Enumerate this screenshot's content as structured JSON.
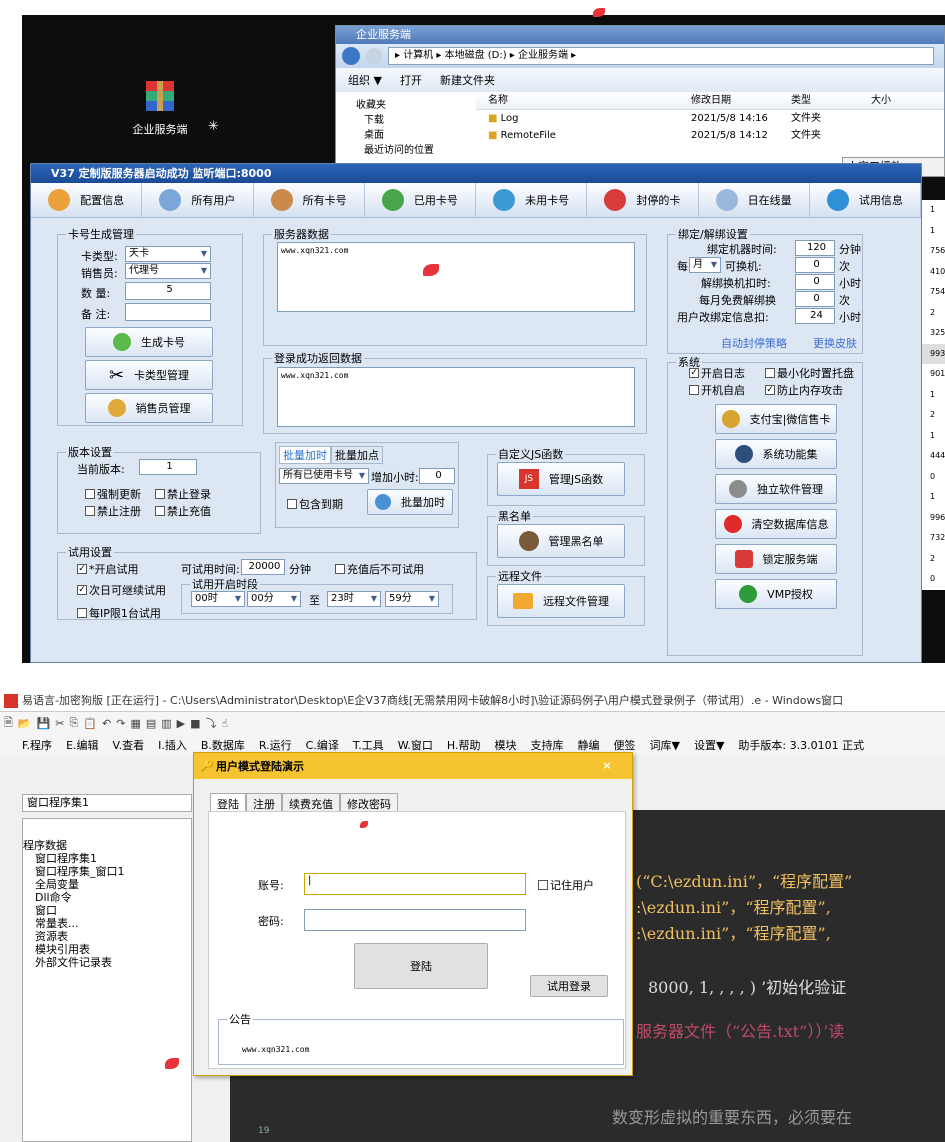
{
  "desktop": {
    "icon_label": "企业服务端"
  },
  "explorer": {
    "title": "企业服务端",
    "address": "▸ 计算机 ▸ 本地磁盘 (D:) ▸ 企业服务端 ▸",
    "toolbar": {
      "organize": "组织 ▼",
      "open": "打开",
      "new_folder": "新建文件夹"
    },
    "nav": [
      "收藏夹",
      "下载",
      "桌面",
      "最近访问的位置"
    ],
    "headers": {
      "name": "名称",
      "date": "修改日期",
      "type": "类型",
      "size": "大小"
    },
    "rows": [
      {
        "name": "Log",
        "date": "2021/5/8 14:16",
        "type": "文件夹"
      },
      {
        "name": "RemoteFile",
        "date": "2021/5/8 14:12",
        "type": "文件夹"
      }
    ]
  },
  "mini_player": "小窗口播放",
  "right_numbers": [
    "1",
    "1",
    "756",
    "410",
    "754",
    "2",
    "325",
    "993",
    "901",
    "1",
    "2",
    "1",
    "444",
    "0",
    "1",
    "996",
    "732",
    "2",
    "0"
  ],
  "server": {
    "title": "V37 定制版服务器启动成功  监听端口:8000",
    "toolbar": [
      "配置信息",
      "所有用户",
      "所有卡号",
      "已用卡号",
      "未用卡号",
      "封停的卡",
      "日在线量",
      "试用信息"
    ],
    "card_gen": {
      "legend": "卡号生成管理",
      "type_label": "卡类型:",
      "type_value": "天卡",
      "seller_label": "销售员:",
      "seller_value": "代理号",
      "qty_label": "数  量:",
      "qty_value": "5",
      "note_label": "备  注:",
      "btn_gen": "生成卡号",
      "btn_type": "卡类型管理",
      "btn_seller": "销售员管理"
    },
    "server_data": {
      "legend": "服务器数据",
      "text": "www.xqn321.com"
    },
    "login_return": {
      "legend": "登录成功返回数据",
      "text": "www.xqn321.com"
    },
    "bind": {
      "legend": "绑定/解绑设置",
      "bind_time": "绑定机器时间:",
      "bind_time_val": "120",
      "bind_time_unit": "分钟",
      "per": "每",
      "month": "月",
      "change": "可换机:",
      "change_val": "0",
      "change_unit": "次",
      "unbind_deduct": "解绑换机扣时:",
      "unbind_val": "0",
      "unbind_unit": "小时",
      "free_unbind": "每月免费解绑换",
      "free_val": "0",
      "free_unit": "次",
      "user_change": "用户改绑定信息扣:",
      "user_change_val": "24",
      "user_change_unit": "小时",
      "link1": "自动封停策略",
      "link2": "更换皮肤"
    },
    "system": {
      "legend": "系统",
      "log": "开启日志",
      "tray": "最小化时置托盘",
      "autostart": "开机自启",
      "mem": "防止内存攻击",
      "btns": [
        "支付宝|微信售卡",
        "系统功能集",
        "独立软件管理",
        "清空数据库信息",
        "锁定服务端",
        "VMP授权"
      ]
    },
    "version": {
      "legend": "版本设置",
      "cur_label": "当前版本:",
      "cur_val": "1",
      "force": "强制更新",
      "no_login": "禁止登录",
      "no_reg": "禁止注册",
      "no_charge": "禁止充值"
    },
    "batch": {
      "tab1": "批量加时",
      "tab2": "批量加点",
      "sel": "所有已使用卡号",
      "add_label": "增加小时:",
      "add_val": "0",
      "expired": "包含到期",
      "btn": "批量加时"
    },
    "custom_js": {
      "legend": "自定义JS函数",
      "btn": "管理JS函数"
    },
    "blacklist": {
      "legend": "黑名单",
      "btn": "管理黑名单"
    },
    "remote": {
      "legend": "远程文件",
      "btn": "远程文件管理"
    },
    "trial": {
      "legend": "试用设置",
      "open": "*开启试用",
      "time_label": "可试用时间:",
      "time_val": "20000",
      "time_unit": "分钟",
      "no_trial_after": "充值后不可试用",
      "next_day": "次日可继续试用",
      "per_ip": "每IP限1台试用",
      "period_legend": "试用开启时段",
      "h1": "00时",
      "m1": "00分",
      "to": "至",
      "h2": "23时",
      "m2": "59分"
    }
  },
  "ide": {
    "title": "易语言-加密狗版 [正在运行] - C:\\Users\\Administrator\\Desktop\\E企V37商线[无需禁用网卡破解8小时]\\验证源码例子\\用户模式登录例子（带试用）.e - Windows窗口",
    "menu": [
      "F.程序",
      "E.编辑",
      "V.查看",
      "I.插入",
      "B.数据库",
      "R.运行",
      "C.编译",
      "T.工具",
      "W.窗口",
      "H.帮助",
      "模块",
      "支持库",
      "静编",
      "便签",
      "词库▼",
      "设置▼",
      "助手版本: 3.3.0101 正式"
    ],
    "combo": "窗口程序集1",
    "tree": [
      "程序数据",
      "窗口程序集1",
      "窗口程序集_窗口1",
      "全局变量",
      "Dll命令",
      "窗口",
      "常量表...",
      "资源表",
      "模块引用表",
      "外部文件记录表"
    ],
    "code": [
      "(“C:\\ezdun.ini”，“程序配置”",
      ":\\ezdun.ini”，“程序配置”,",
      ":\\ezdun.ini”，“程序配置”,",
      "8000, 1, , , , ) ’初始化验证",
      "服务器文件（“公告.txt”））’读",
      "数变形虚拟的重要东西，必须要在"
    ],
    "line_no": "19"
  },
  "login": {
    "title": "用户模式登陆演示",
    "close": "×",
    "tabs": [
      "登陆",
      "注册",
      "续费充值",
      "修改密码"
    ],
    "account_label": "账号:",
    "password_label": "密码:",
    "remember": "记住用户",
    "login_btn": "登陆",
    "trial_btn": "试用登录",
    "notice_legend": "公告",
    "notice_text": "www.xqn321.com"
  }
}
